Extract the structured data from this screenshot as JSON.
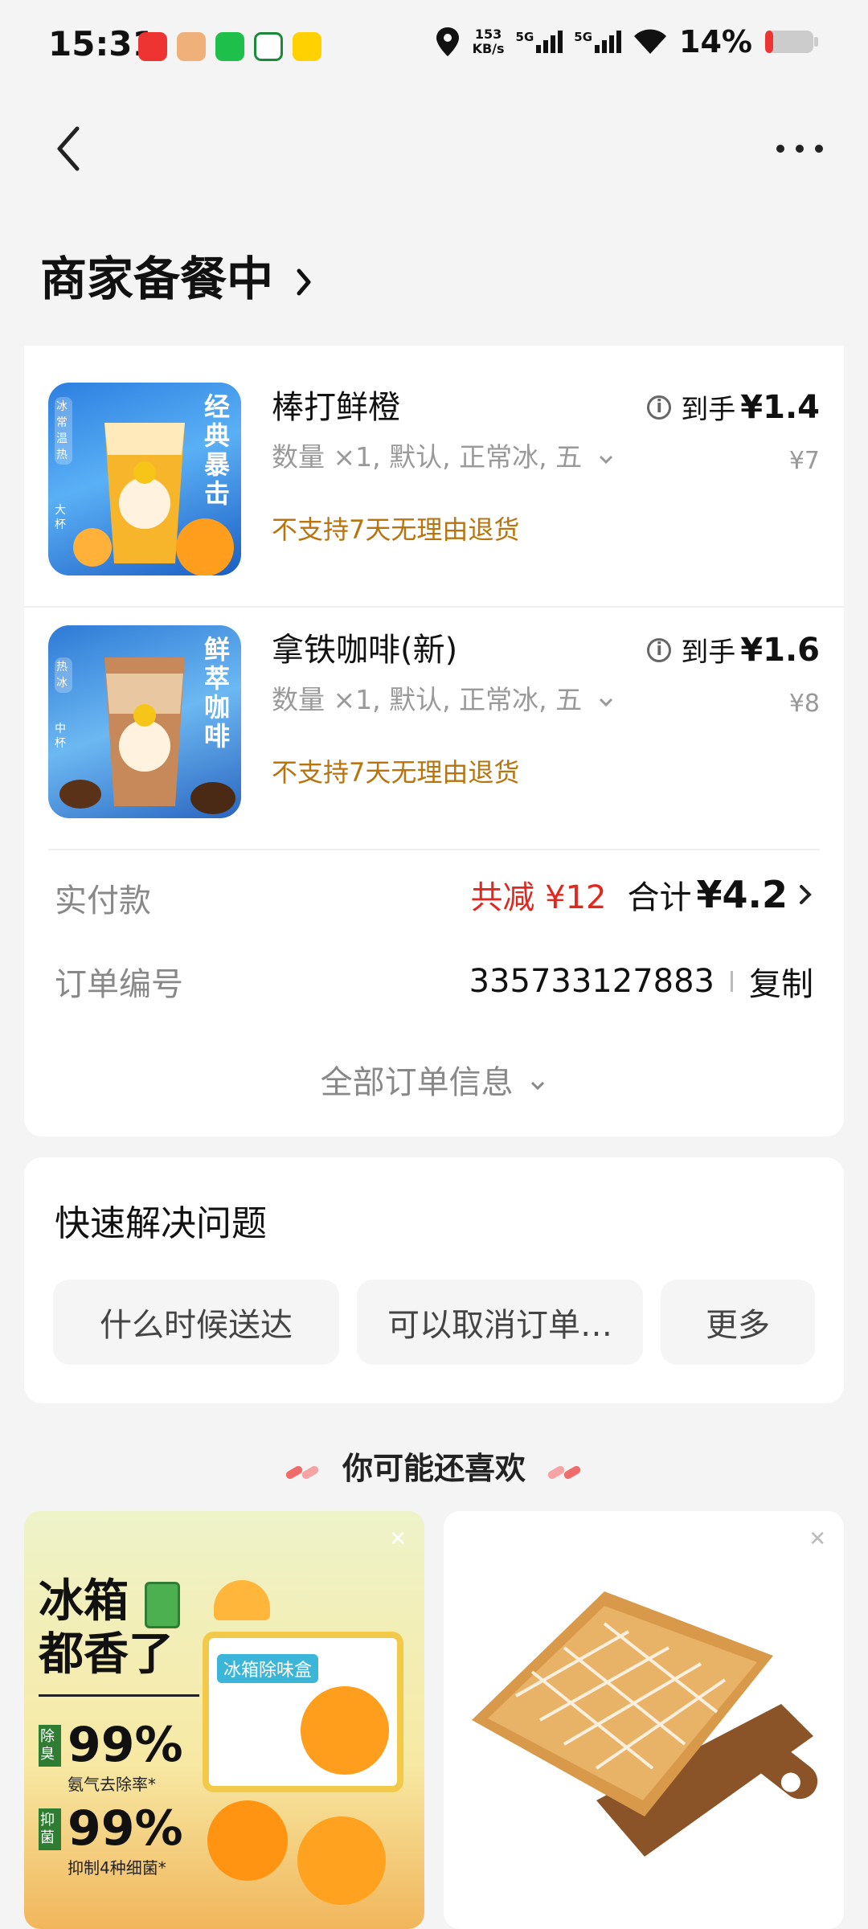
{
  "status": {
    "time": "15:31",
    "speed_value": "153",
    "speed_unit": "KB/s",
    "sig1": "5G",
    "sig2": "5G",
    "battery": "14%"
  },
  "header": {
    "title": "商家备餐中"
  },
  "order": {
    "items": [
      {
        "name": "棒打鲜橙",
        "spec": "数量 ×1, 默认, 正常冰, 五",
        "note": "不支持7天无理由退货",
        "price_prefix": "到手",
        "price": "¥1.4",
        "original": "¥7",
        "img_text": "经典暴击",
        "img_tags": "冰 常温 热",
        "img_size": "大杯"
      },
      {
        "name": "拿铁咖啡(新)",
        "spec": "数量 ×1, 默认, 正常冰, 五",
        "note": "不支持7天无理由退货",
        "price_prefix": "到手",
        "price": "¥1.6",
        "original": "¥8",
        "img_text": "鲜萃咖啡",
        "img_tags": "热 冰",
        "img_size": "中杯"
      }
    ],
    "paid_label": "实付款",
    "discount": "共减 ¥12",
    "total_label": "合计",
    "total_value": "¥4.2",
    "order_no_label": "订单编号",
    "order_no": "335733127883",
    "copy_label": "复制",
    "all_info_label": "全部订单信息"
  },
  "quick": {
    "title": "快速解决问题",
    "chips": [
      "什么时候送达",
      "可以取消订单…",
      "更多"
    ]
  },
  "recommend": {
    "title": "你可能还喜欢",
    "left_ad": {
      "headline1": "冰箱",
      "headline2": "都香了",
      "stat1_tag": "除臭",
      "stat1_value": "99%",
      "stat1_text": "氨气去除率*",
      "stat2_tag": "抑菌",
      "stat2_value": "99%",
      "stat2_text": "抑制4种细菌*",
      "box_label": "冰箱除味盒"
    }
  }
}
